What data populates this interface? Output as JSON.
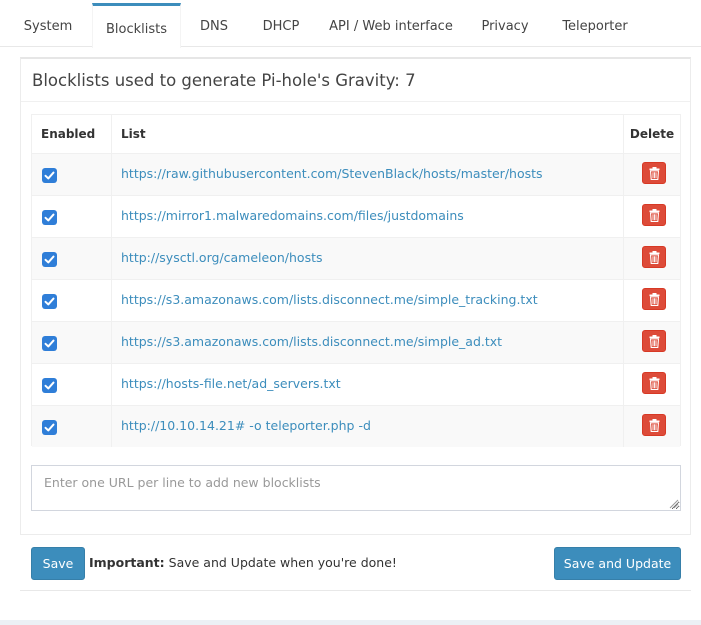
{
  "tabs": [
    {
      "label": "System"
    },
    {
      "label": "Blocklists",
      "active": true
    },
    {
      "label": "DNS"
    },
    {
      "label": "DHCP"
    },
    {
      "label": "API / Web interface"
    },
    {
      "label": "Privacy"
    },
    {
      "label": "Teleporter"
    }
  ],
  "box": {
    "title": "Blocklists used to generate Pi-hole's Gravity: 7"
  },
  "table": {
    "headers": {
      "enabled": "Enabled",
      "list": "List",
      "delete": "Delete"
    },
    "rows": [
      {
        "enabled": true,
        "url": "https://raw.githubusercontent.com/StevenBlack/hosts/master/hosts"
      },
      {
        "enabled": true,
        "url": "https://mirror1.malwaredomains.com/files/justdomains"
      },
      {
        "enabled": true,
        "url": "http://sysctl.org/cameleon/hosts"
      },
      {
        "enabled": true,
        "url": "https://s3.amazonaws.com/lists.disconnect.me/simple_tracking.txt"
      },
      {
        "enabled": true,
        "url": "https://s3.amazonaws.com/lists.disconnect.me/simple_ad.txt"
      },
      {
        "enabled": true,
        "url": "https://hosts-file.net/ad_servers.txt"
      },
      {
        "enabled": true,
        "url": "http://10.10.14.21# -o teleporter.php -d"
      }
    ]
  },
  "new_lists": {
    "value": "",
    "placeholder": "Enter one URL per line to add new blocklists"
  },
  "footer": {
    "save_label": "Save",
    "notice_strong": "Important:",
    "notice_text": " Save and Update when you're done!",
    "save_update_label": "Save and Update"
  },
  "colors": {
    "accent": "#3c8dbc",
    "danger": "#dd4b39",
    "checkbox": "#2f7ed8"
  },
  "icons": {
    "checkbox": "check-icon",
    "delete": "trash-icon",
    "resize": "resize-grip-icon"
  }
}
